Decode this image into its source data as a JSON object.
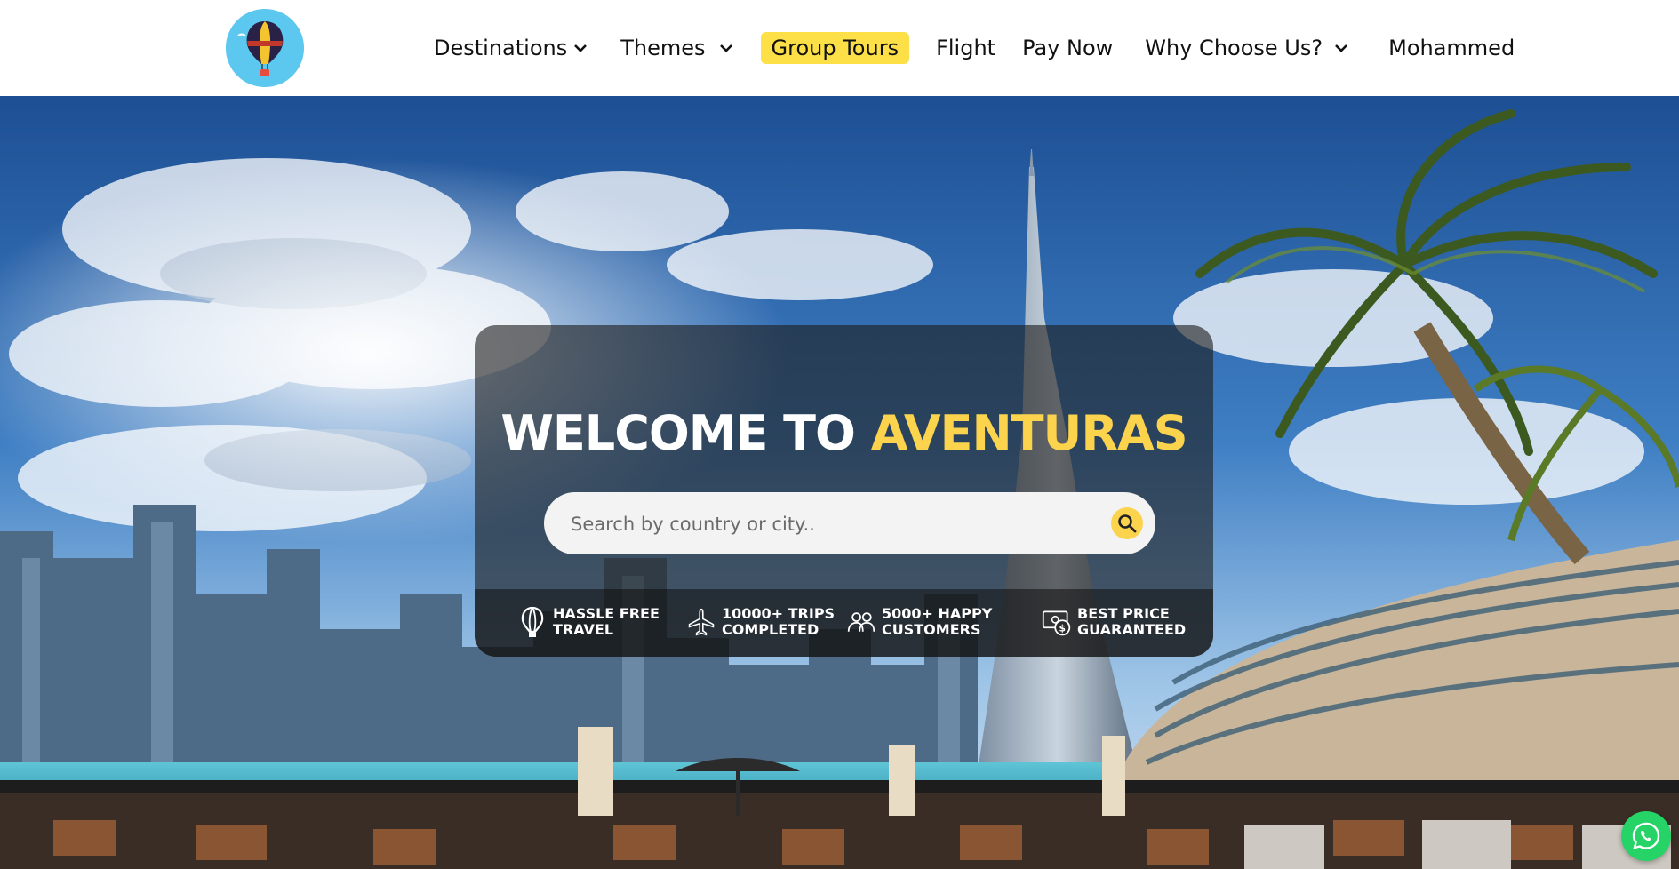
{
  "header": {
    "logo_alt": "Aventuras",
    "nav": [
      {
        "label": "Destinations",
        "dropdown": true
      },
      {
        "label": "Themes",
        "dropdown": true
      },
      {
        "label": "Group Tours",
        "highlight": true
      },
      {
        "label": "Flight"
      },
      {
        "label": "Pay Now"
      },
      {
        "label": "Why Choose Us?",
        "dropdown": true
      },
      {
        "label": "Mohammed"
      }
    ]
  },
  "hero": {
    "welcome_prefix": "WELCOME TO",
    "welcome_brand": "AVENTURAS",
    "search": {
      "placeholder": "Search by country or city.."
    },
    "features": [
      {
        "icon": "balloon-icon",
        "label": "HASSLE FREE\nTRAVEL"
      },
      {
        "icon": "airplane-icon",
        "label": "10000+ TRIPS\nCOMPLETED"
      },
      {
        "icon": "people-icon",
        "label": "5000+ HAPPY\nCUSTOMERS"
      },
      {
        "icon": "money-icon",
        "label": "BEST PRICE\nGUARANTEED"
      }
    ]
  },
  "colors": {
    "accent": "#fde047",
    "brand_yellow": "#fcd34d",
    "whatsapp": "#25d366"
  }
}
